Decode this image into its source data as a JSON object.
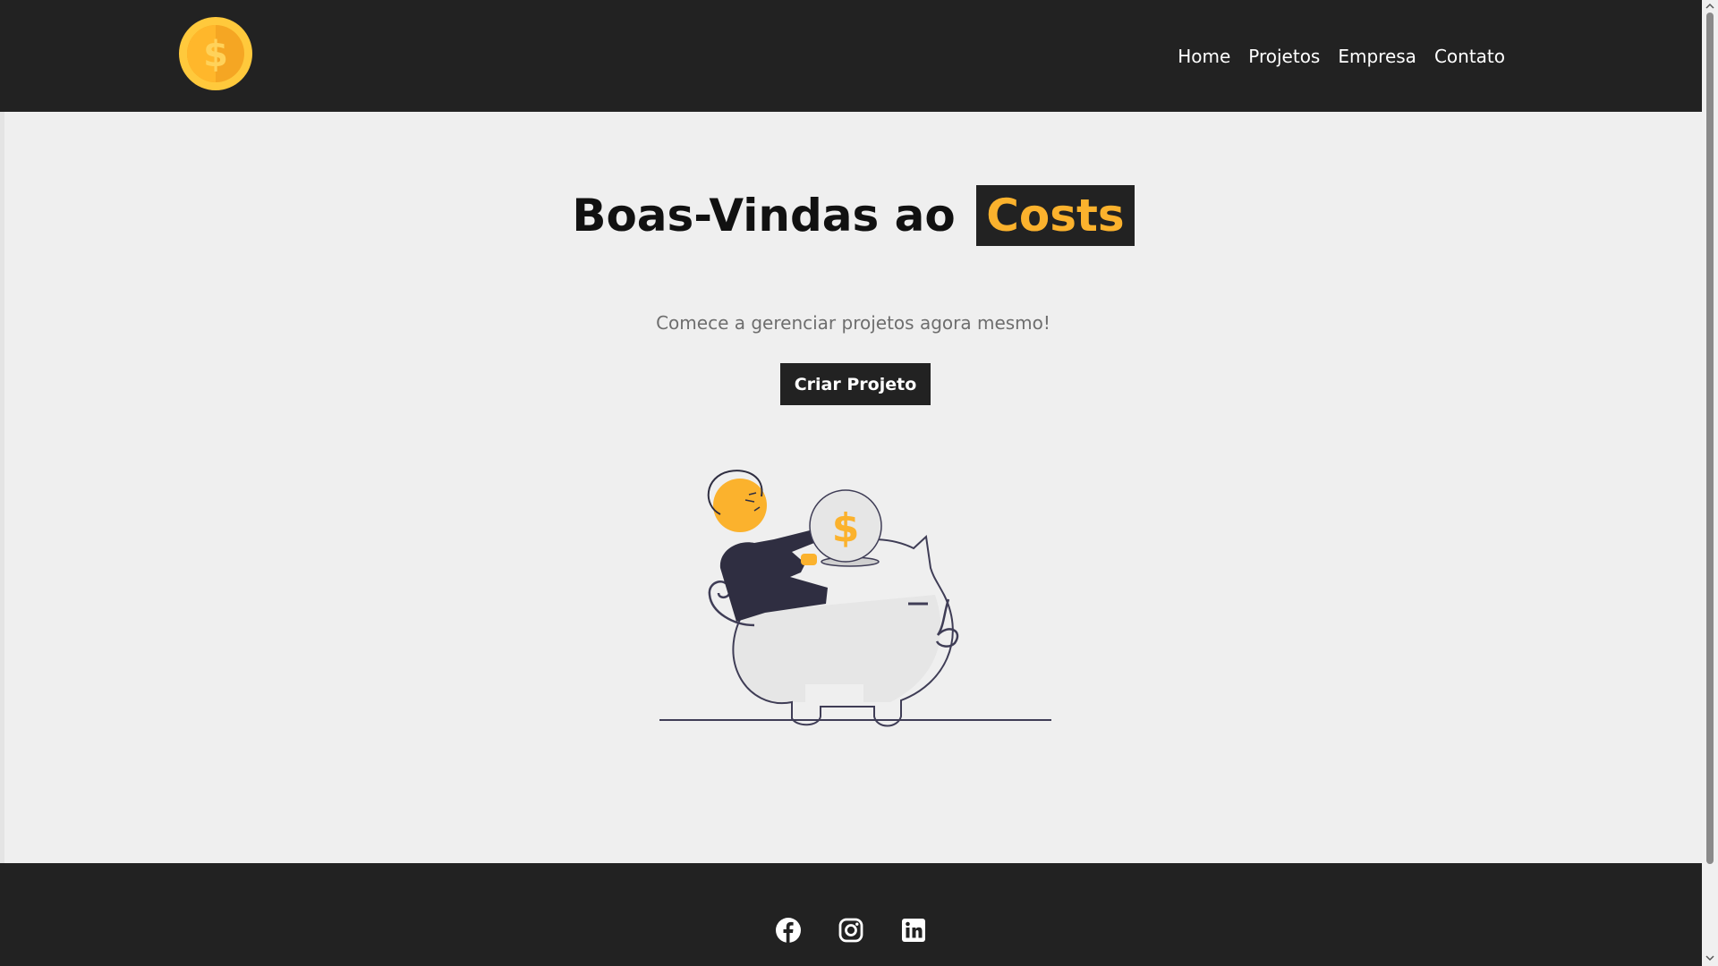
{
  "header": {
    "logo_icon": "coin-dollar-icon",
    "nav": [
      {
        "label": "Home"
      },
      {
        "label": "Projetos"
      },
      {
        "label": "Empresa"
      },
      {
        "label": "Contato"
      }
    ]
  },
  "hero": {
    "title_prefix": "Boas-Vindas ao",
    "title_brand": "Costs",
    "subtitle": "Comece a gerenciar projetos agora mesmo!",
    "cta_label": "Criar Projeto",
    "illustration_icon": "piggy-bank-illustration"
  },
  "footer": {
    "socials": [
      {
        "icon": "facebook-icon"
      },
      {
        "icon": "instagram-icon"
      },
      {
        "icon": "linkedin-icon"
      }
    ]
  },
  "colors": {
    "dark": "#222222",
    "accent": "#fbb22d",
    "background": "#efefef",
    "muted_text": "#6e6e6e"
  }
}
